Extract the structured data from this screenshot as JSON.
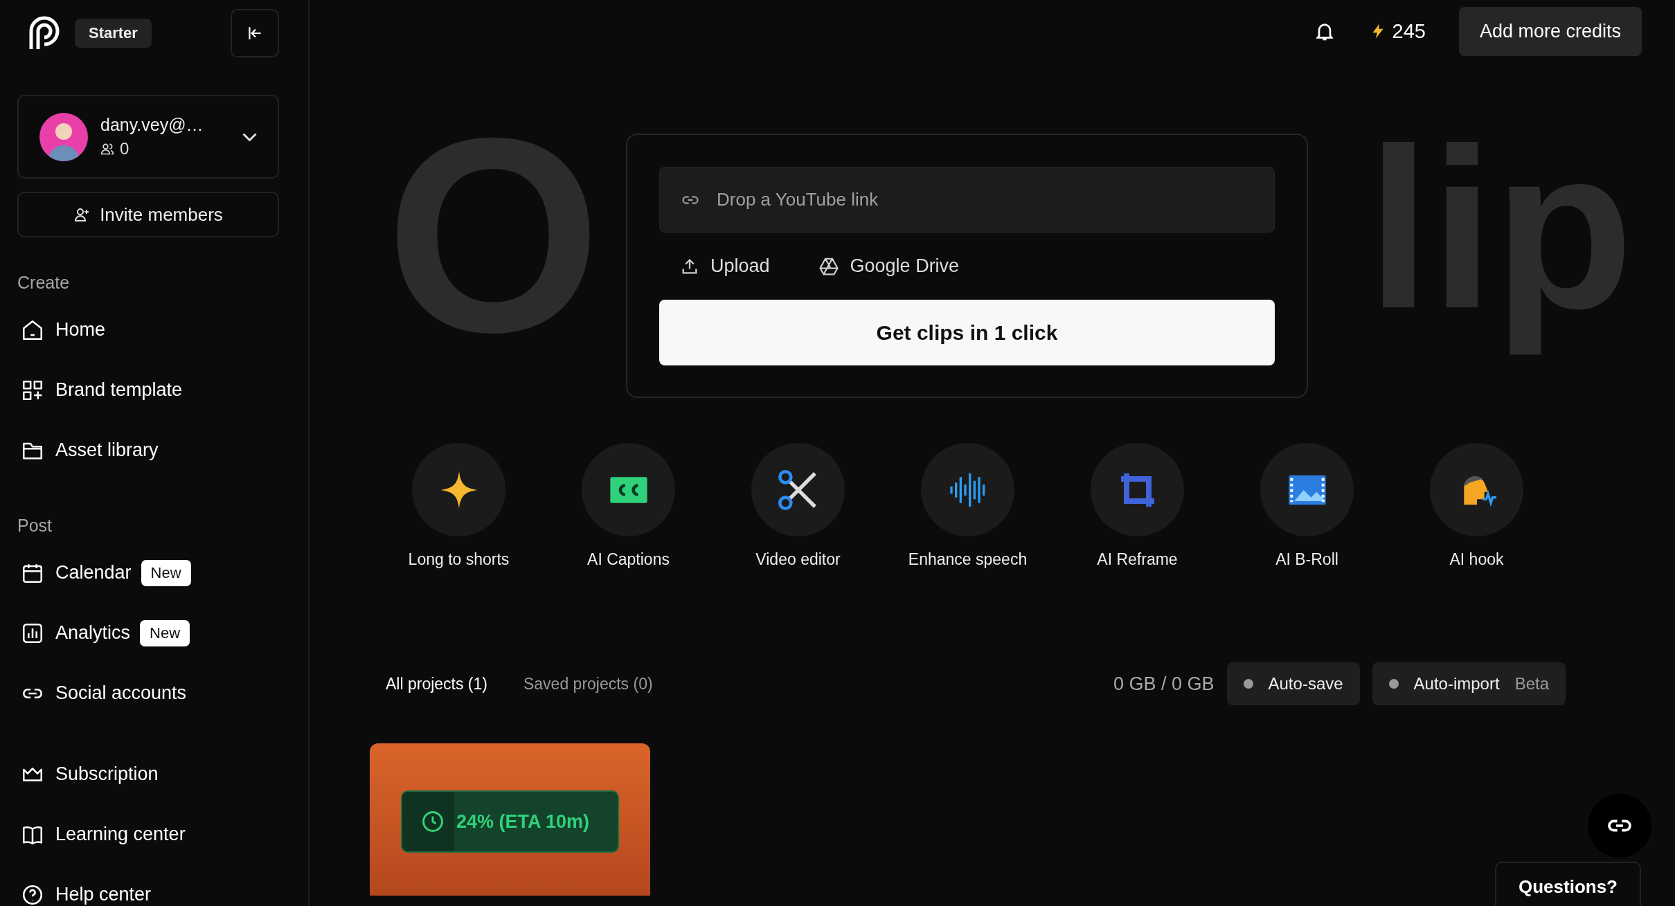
{
  "sidebar": {
    "plan_badge": "Starter",
    "account": {
      "email": "dany.vey@…",
      "members": "0"
    },
    "invite_button": "Invite members",
    "sections": [
      {
        "title": "Create",
        "items": [
          {
            "label": "Home",
            "kind": "home"
          },
          {
            "label": "Brand template",
            "kind": "grid"
          },
          {
            "label": "Asset library",
            "kind": "folder"
          }
        ]
      },
      {
        "title": "Post",
        "items": [
          {
            "label": "Calendar",
            "kind": "calendar",
            "badge": "New"
          },
          {
            "label": "Analytics",
            "kind": "chart",
            "badge": "New"
          },
          {
            "label": "Social accounts",
            "kind": "link"
          }
        ]
      },
      {
        "items": [
          {
            "label": "Subscription",
            "kind": "crown"
          },
          {
            "label": "Learning center",
            "kind": "book"
          },
          {
            "label": "Help center",
            "kind": "help"
          }
        ]
      }
    ]
  },
  "top_bar": {
    "credits": "245",
    "add_credits_button": "Add more credits"
  },
  "hero": {
    "backdrop_letters": [
      "O",
      "lip"
    ],
    "link_field": {
      "placeholder": "Drop a YouTube link"
    },
    "upload": "Upload",
    "google_drive": "Google Drive",
    "cta_button": "Get clips in 1 click"
  },
  "tools": [
    {
      "label": "Long to shorts",
      "kind": "sparkle"
    },
    {
      "label": "AI Captions",
      "kind": "captions"
    },
    {
      "label": "Video editor",
      "kind": "scissors"
    },
    {
      "label": "Enhance speech",
      "kind": "wave"
    },
    {
      "label": "AI Reframe",
      "kind": "crop"
    },
    {
      "label": "AI B-Roll",
      "kind": "film"
    },
    {
      "label": "AI hook",
      "kind": "hook"
    }
  ],
  "projects": {
    "tabs": [
      {
        "label": "All projects (1)",
        "selected": true
      },
      {
        "label": "Saved projects (0)",
        "selected": false
      }
    ],
    "storage": "0 GB / 0 GB",
    "toggles": [
      {
        "label": "Auto-save",
        "on": false
      },
      {
        "label": "Auto-import",
        "tag": "Beta",
        "on": false
      }
    ],
    "cards": [
      {
        "progress": "24% (ETA 10m)",
        "level": 0.24
      }
    ]
  },
  "help_button": "Questions?"
}
